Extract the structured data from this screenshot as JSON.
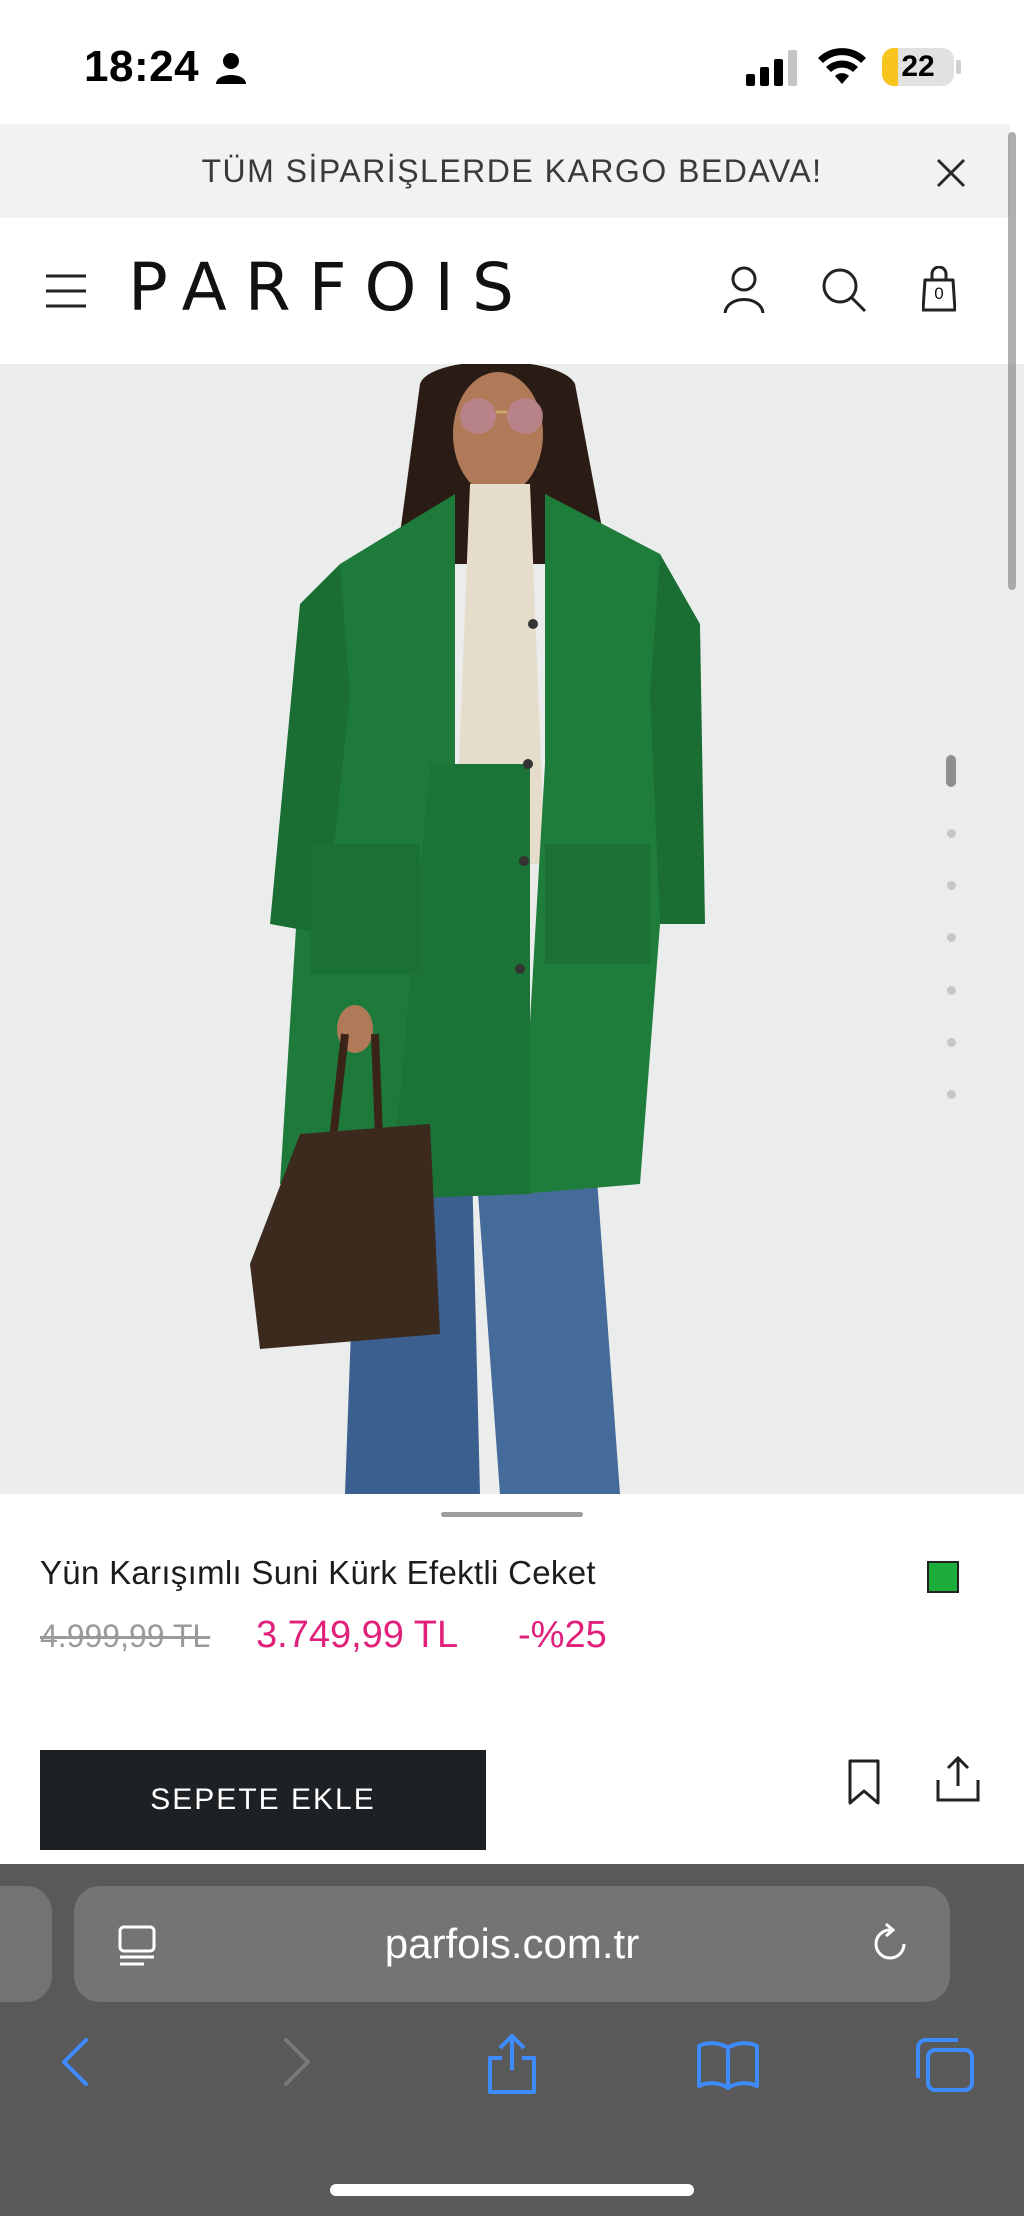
{
  "status_bar": {
    "time": "18:24",
    "battery_level": "22",
    "battery_fraction": 0.22,
    "icons": [
      "person-icon",
      "signal-icon",
      "wifi-icon",
      "battery-icon"
    ]
  },
  "promo": {
    "text": "TÜM SİPARİŞLERDE KARGO BEDAVA!",
    "close_icon": "close-icon"
  },
  "header": {
    "logo": "PARFOIS",
    "bag_count": "0",
    "icons": [
      "menu-icon",
      "account-icon",
      "search-icon",
      "bag-icon"
    ]
  },
  "gallery": {
    "image_count": 7,
    "active_index": 0
  },
  "product": {
    "title": "Yün Karışımlı Suni Kürk Efektli Ceket",
    "old_price": "4.999,99 TL",
    "new_price": "3.749,99 TL",
    "discount": "-%25",
    "color_hex": "#1ead3b",
    "add_to_cart_label": "SEPETE EKLE"
  },
  "browser": {
    "url": "parfois.com.tr",
    "icons": [
      "reader-icon",
      "reload-icon",
      "back-icon",
      "forward-icon",
      "share-icon",
      "bookmarks-icon",
      "tabs-icon"
    ]
  },
  "colors": {
    "accent_price": "#e0207a",
    "button_dark": "#1e2124",
    "coat_green": "#1e7a3a"
  }
}
